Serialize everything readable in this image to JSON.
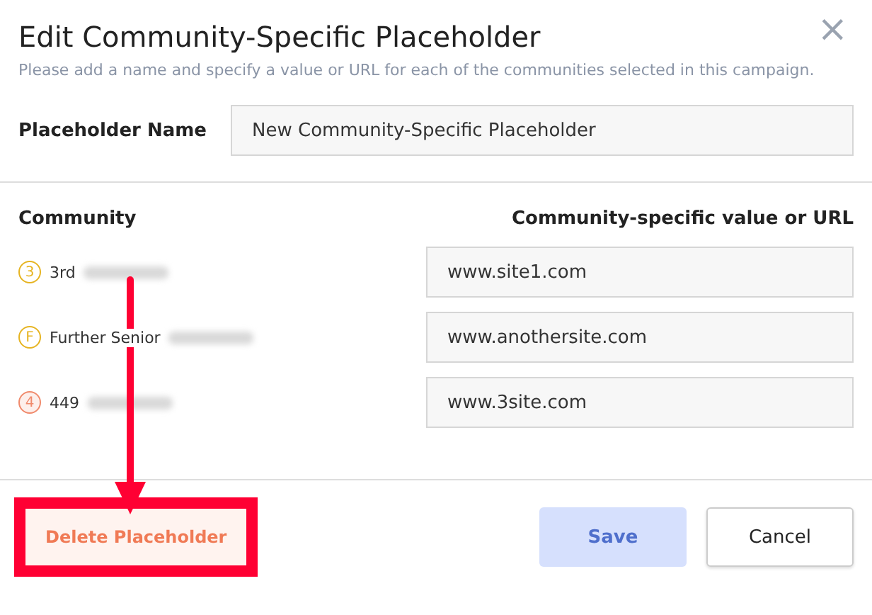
{
  "dialog": {
    "title": "Edit Community-Specific Placeholder",
    "subtitle": "Please add a name and specify a value or URL for each of the communities selected in this campaign.",
    "close": "×"
  },
  "placeholder_name": {
    "label": "Placeholder Name",
    "value": "New Community-Specific Placeholder"
  },
  "columns": [
    "Community",
    "Community-specific value or URL"
  ],
  "communities": [
    {
      "badge": "3",
      "color": "#e6b422",
      "name": "3rd",
      "value": "www.site1.com"
    },
    {
      "badge": "F",
      "color": "#e6b422",
      "name": "Further Senior",
      "value": "www.anothersite.com"
    },
    {
      "badge": "4",
      "color": "#f08a6c",
      "name": "449",
      "value": "www.3site.com"
    }
  ],
  "buttons": {
    "delete": "Delete Placeholder",
    "save": {
      "label": "Save",
      "disabled": true
    },
    "cancel": "Cancel"
  }
}
